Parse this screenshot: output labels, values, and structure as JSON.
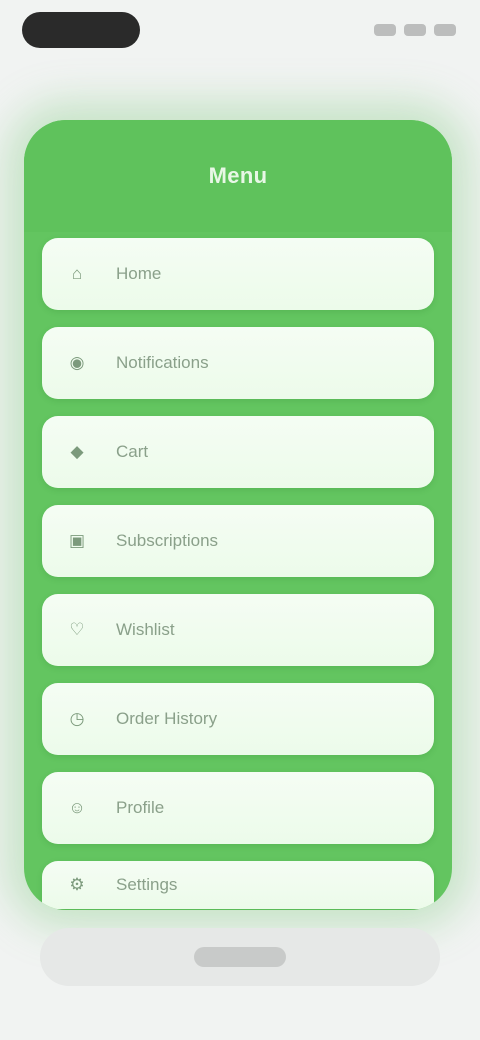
{
  "status_bar": {
    "time": "",
    "indicators": [
      "signal",
      "wifi",
      "battery"
    ]
  },
  "nav": {
    "back_label": ""
  },
  "card": {
    "title": "Menu",
    "accent_color": "#63c560",
    "items": [
      {
        "label": "Home",
        "icon": "home-icon",
        "glyph": "⌂"
      },
      {
        "label": "Notifications",
        "icon": "bell-icon",
        "glyph": "◉"
      },
      {
        "label": "Cart",
        "icon": "cart-icon",
        "glyph": "◆"
      },
      {
        "label": "Subscriptions",
        "icon": "list-icon",
        "glyph": "▣"
      },
      {
        "label": "Wishlist",
        "icon": "heart-icon",
        "glyph": "♡"
      },
      {
        "label": "Order History",
        "icon": "clock-icon",
        "glyph": "◷"
      },
      {
        "label": "Profile",
        "icon": "user-icon",
        "glyph": "☺"
      },
      {
        "label": "Settings",
        "icon": "gear-icon",
        "glyph": "⚙"
      }
    ]
  },
  "bottom": {
    "home_indicator": ""
  }
}
